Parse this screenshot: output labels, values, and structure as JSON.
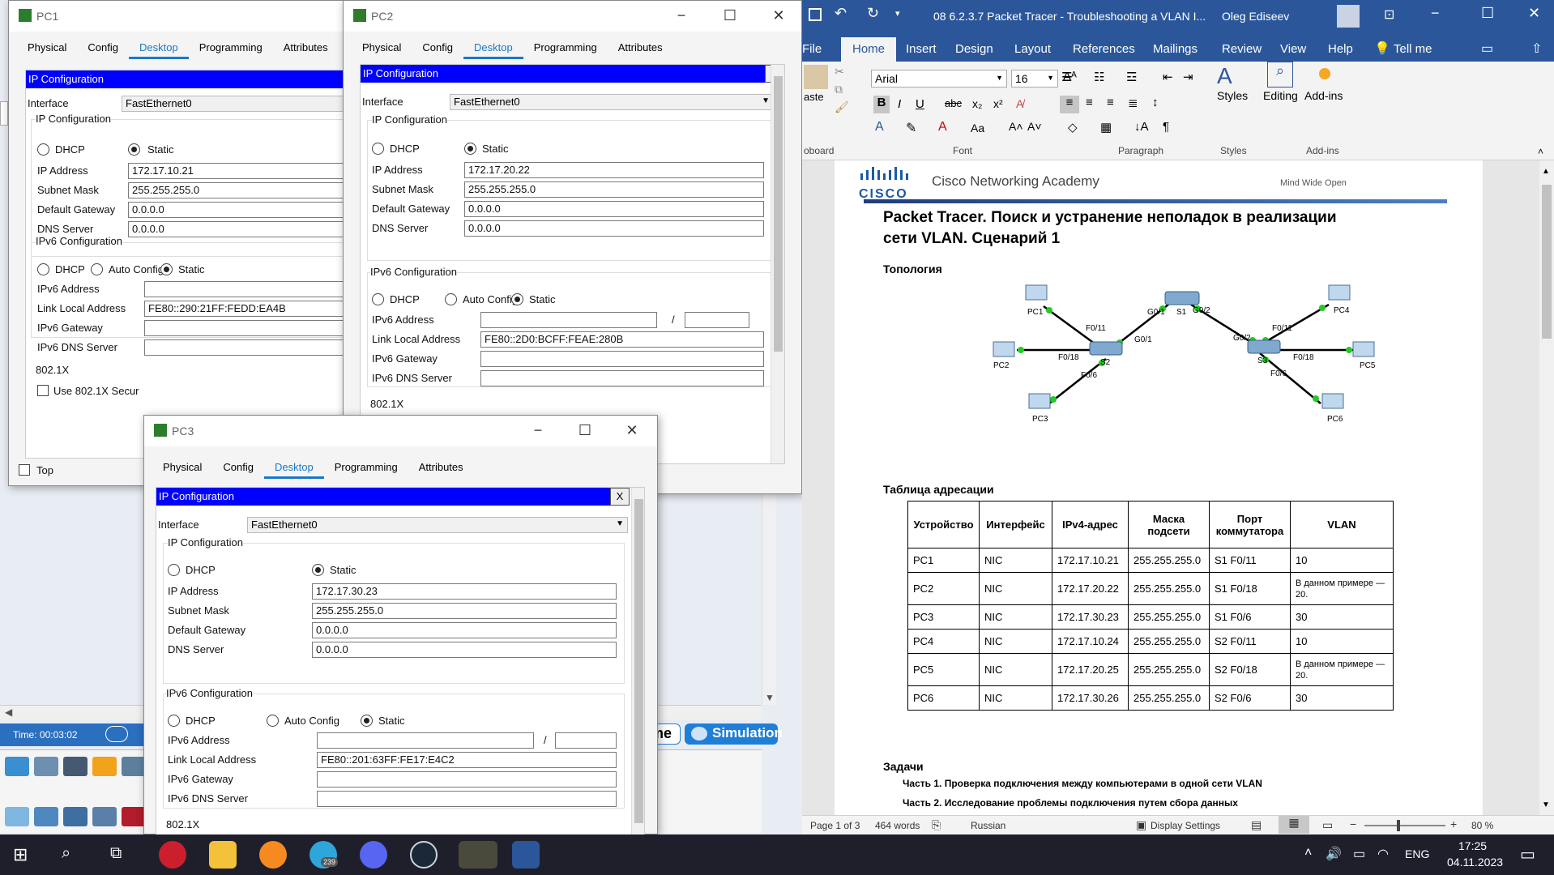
{
  "packet_tracer": {
    "time_label": "Time: 00:03:02",
    "realtime_label": "me",
    "simulation_label": "Simulation"
  },
  "pc1": {
    "title": "PC1",
    "tabs": [
      "Physical",
      "Config",
      "Desktop",
      "Programming",
      "Attributes"
    ],
    "header": "IP Configuration",
    "interface_label": "Interface",
    "interface_value": "FastEthernet0",
    "ipconf_group": "IP Configuration",
    "dhcp": "DHCP",
    "static": "Static",
    "ip_label": "IP Address",
    "ip": "172.17.10.21",
    "mask_label": "Subnet Mask",
    "mask": "255.255.255.0",
    "gw_label": "Default Gateway",
    "gw": "0.0.0.0",
    "dns_label": "DNS Server",
    "dns": "0.0.0.0",
    "ipv6_group": "IPv6 Configuration",
    "auto_config": "Auto Config",
    "ipv6_addr_label": "IPv6 Address",
    "ipv6_addr": "",
    "lla_label": "Link Local Address",
    "lla": "FE80::290:21FF:FEDD:EA4B",
    "ipv6_gw_label": "IPv6 Gateway",
    "ipv6_gw": "",
    "ipv6_dns_label": "IPv6 DNS Server",
    "ipv6_dns": "",
    "dot1x": "802.1X",
    "use_8021x": "Use 802.1X Secur",
    "top": "Top"
  },
  "pc2": {
    "title": "PC2",
    "tabs": [
      "Physical",
      "Config",
      "Desktop",
      "Programming",
      "Attributes"
    ],
    "header": "IP Configuration",
    "close": "X",
    "interface_label": "Interface",
    "interface_value": "FastEthernet0",
    "ipconf_group": "IP Configuration",
    "dhcp": "DHCP",
    "static": "Static",
    "ip_label": "IP Address",
    "ip": "172.17.20.22",
    "mask_label": "Subnet Mask",
    "mask": "255.255.255.0",
    "gw_label": "Default Gateway",
    "gw": "0.0.0.0",
    "dns_label": "DNS Server",
    "dns": "0.0.0.0",
    "ipv6_group": "IPv6 Configuration",
    "auto_config": "Auto Config",
    "ipv6_addr_label": "IPv6 Address",
    "ipv6_addr": "",
    "ipv6_prefix": "",
    "slash": "/",
    "lla_label": "Link Local Address",
    "lla": "FE80::2D0:BCFF:FEAE:280B",
    "ipv6_gw_label": "IPv6 Gateway",
    "ipv6_gw": "",
    "ipv6_dns_label": "IPv6 DNS Server",
    "ipv6_dns": "",
    "dot1x": "802.1X"
  },
  "pc3": {
    "title": "PC3",
    "tabs": [
      "Physical",
      "Config",
      "Desktop",
      "Programming",
      "Attributes"
    ],
    "header": "IP Configuration",
    "close": "X",
    "interface_label": "Interface",
    "interface_value": "FastEthernet0",
    "ipconf_group": "IP Configuration",
    "dhcp": "DHCP",
    "static": "Static",
    "ip_label": "IP Address",
    "ip": "172.17.30.23",
    "mask_label": "Subnet Mask",
    "mask": "255.255.255.0",
    "gw_label": "Default Gateway",
    "gw": "0.0.0.0",
    "dns_label": "DNS Server",
    "dns": "0.0.0.0",
    "ipv6_group": "IPv6 Configuration",
    "auto_config": "Auto Config",
    "ipv6_addr_label": "IPv6 Address",
    "ipv6_addr": "",
    "ipv6_prefix": "",
    "slash": "/",
    "lla_label": "Link Local Address",
    "lla": "FE80::201:63FF:FE17:E4C2",
    "ipv6_gw_label": "IPv6 Gateway",
    "ipv6_gw": "",
    "ipv6_dns_label": "IPv6 DNS Server",
    "ipv6_dns": "",
    "dot1x": "802.1X"
  },
  "word": {
    "title": "08 6.2.3.7 Packet Tracer - Troubleshooting a VLAN I...",
    "user": "Oleg Ediseev",
    "tabs": [
      "File",
      "Home",
      "Insert",
      "Design",
      "Layout",
      "References",
      "Mailings",
      "Review",
      "View",
      "Help"
    ],
    "tell_me": "Tell me",
    "font_name": "Arial",
    "font_size": "16",
    "groups": {
      "clipboard": "oboard",
      "font": "Font",
      "paragraph": "Paragraph",
      "styles": "Styles",
      "addins": "Add-ins"
    },
    "paste": "aste",
    "styles_btn": "Styles",
    "editing_btn": "Editing",
    "addins_btn": "Add-ins",
    "status": {
      "page": "Page 1 of 3",
      "words": "464 words",
      "lang": "Russian",
      "display": "Display Settings",
      "zoom": "80 %"
    }
  },
  "doc": {
    "cisco": "CISCO",
    "academy": "Cisco Networking Academy",
    "tagline": "Mind Wide Open",
    "title_line1": "Packet Tracer. Поиск и устранение неполадок в реализации",
    "title_line2": "сети VLAN. Сценарий 1",
    "topology_heading": "Топология",
    "table_heading": "Таблица адресации",
    "table_headers": [
      "Устройство",
      "Интерфейс",
      "IPv4-адрес",
      "Маска подсети",
      "Порт коммутатора",
      "VLAN"
    ],
    "table_rows": [
      [
        "PC1",
        "NIC",
        "172.17.10.21",
        "255.255.255.0",
        "S1 F0/11",
        "10"
      ],
      [
        "PC2",
        "NIC",
        "172.17.20.22",
        "255.255.255.0",
        "S1 F0/18",
        "В данном примере — 20."
      ],
      [
        "PC3",
        "NIC",
        "172.17.30.23",
        "255.255.255.0",
        "S1 F0/6",
        "30"
      ],
      [
        "PC4",
        "NIC",
        "172.17.10.24",
        "255.255.255.0",
        "S2 F0/11",
        "10"
      ],
      [
        "PC5",
        "NIC",
        "172.17.20.25",
        "255.255.255.0",
        "S2 F0/18",
        "В данном примере — 20."
      ],
      [
        "PC6",
        "NIC",
        "172.17.30.26",
        "255.255.255.0",
        "S2 F0/6",
        "30"
      ]
    ],
    "tasks_heading": "Задачи",
    "task1": "Часть 1. Проверка подключения между компьютерами в одной сети VLAN",
    "task2": "Часть 2. Исследование проблемы подключения путем сбора данных",
    "topology": {
      "pc1": "PC1",
      "pc2": "PC2",
      "pc3": "PC3",
      "pc4": "PC4",
      "pc5": "PC5",
      "pc6": "PC6",
      "s1": "S1",
      "s2": "S2",
      "s3": "S3",
      "g01a": "G0/1",
      "g02a": "G0/2",
      "g01b": "G0/1",
      "g02b": "G0/2",
      "f011a": "F0/11",
      "f018a": "F0/18",
      "f06a": "F0/6",
      "f011b": "F0/11",
      "f018b": "F0/18",
      "f06b": "F0/6"
    }
  },
  "taskbar": {
    "telegram_badge": "239",
    "lang": "ENG",
    "time": "17:25",
    "date": "04.11.2023"
  }
}
